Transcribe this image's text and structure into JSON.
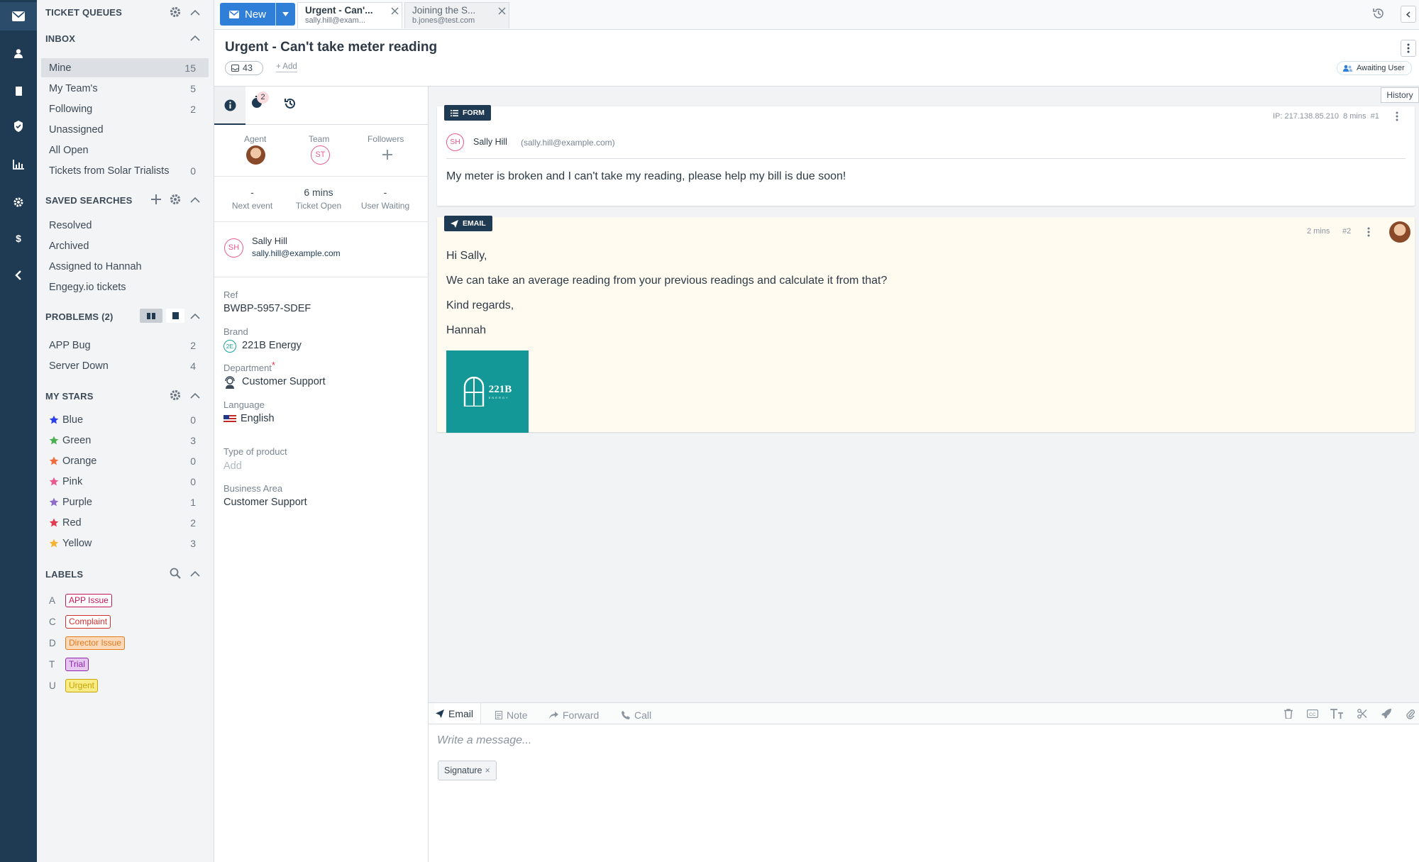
{
  "rail": {
    "icons": [
      "mail-icon",
      "user-icon",
      "book-icon",
      "check-shield-icon",
      "bar-chart-icon",
      "cog-icon",
      "dollar-icon",
      "chevron-left-icon"
    ]
  },
  "sidebar": {
    "queues_title": "TICKET QUEUES",
    "inbox_title": "INBOX",
    "inbox": [
      {
        "label": "Mine",
        "count": "15"
      },
      {
        "label": "My Team's",
        "count": "5"
      },
      {
        "label": "Following",
        "count": "2"
      },
      {
        "label": "Unassigned",
        "count": ""
      },
      {
        "label": "All Open",
        "count": ""
      },
      {
        "label": "Tickets from Solar Trialists",
        "count": "0"
      }
    ],
    "saved_title": "SAVED SEARCHES",
    "saved": [
      {
        "label": "Resolved"
      },
      {
        "label": "Archived"
      },
      {
        "label": "Assigned to Hannah"
      },
      {
        "label": "Engegy.io tickets"
      }
    ],
    "problems_title": "PROBLEMS (2)",
    "problems": [
      {
        "label": "APP Bug",
        "count": "2"
      },
      {
        "label": "Server Down",
        "count": "4"
      }
    ],
    "stars_title": "MY STARS",
    "stars": [
      {
        "label": "Blue",
        "count": "0",
        "color": "#2b3ff0"
      },
      {
        "label": "Green",
        "count": "3",
        "color": "#4caf50"
      },
      {
        "label": "Orange",
        "count": "0",
        "color": "#f26b3a"
      },
      {
        "label": "Pink",
        "count": "0",
        "color": "#e8598f"
      },
      {
        "label": "Purple",
        "count": "1",
        "color": "#8e6cc9"
      },
      {
        "label": "Red",
        "count": "2",
        "color": "#e53950"
      },
      {
        "label": "Yellow",
        "count": "3",
        "color": "#f5b332"
      }
    ],
    "labels_title": "LABELS",
    "labels": [
      {
        "letter": "A",
        "label": "APP Issue",
        "color": "#c2185b",
        "bg": "#fff"
      },
      {
        "letter": "C",
        "label": "Complaint",
        "color": "#d32f2f",
        "bg": "#fff"
      },
      {
        "letter": "D",
        "label": "Director Issue",
        "color": "#e07a1f",
        "bg": "#fbd9b9"
      },
      {
        "letter": "T",
        "label": "Trial",
        "color": "#8e24aa",
        "bg": "#e5c7f0"
      },
      {
        "letter": "U",
        "label": "Urgent",
        "color": "#c9a400",
        "bg": "#f8ec86"
      }
    ]
  },
  "topbar": {
    "new_label": "New",
    "tabs": [
      {
        "title": "Urgent - Can'...",
        "sub": "sally.hill@exam..."
      },
      {
        "title": "Joining the S...",
        "sub": "b.jones@test.com"
      }
    ]
  },
  "ticket": {
    "title": "Urgent - Can't take meter reading",
    "count": "43",
    "add_label": "+ Add",
    "status": "Awaiting User",
    "history_tooltip": "History"
  },
  "props": {
    "tab_badge": "2",
    "agent_label": "Agent",
    "team_label": "Team",
    "followers_label": "Followers",
    "team_initials": "ST",
    "stats": [
      {
        "value": "-",
        "label": "Next event"
      },
      {
        "value": "6 mins",
        "label": "Ticket Open"
      },
      {
        "value": "-",
        "label": "User Waiting"
      }
    ],
    "user_initials": "SH",
    "user_name": "Sally Hill",
    "user_email": "sally.hill@example.com",
    "ref_label": "Ref",
    "ref_value": "BWBP-5957-SDEF",
    "brand_label": "Brand",
    "brand_initials": "2E",
    "brand_value": "221B Energy",
    "dept_label": "Department",
    "dept_req": "*",
    "dept_value": "Customer Support",
    "lang_label": "Language",
    "lang_value": "English",
    "product_label": "Type of product",
    "product_value": "Add",
    "area_label": "Business Area",
    "area_value": "Customer Support"
  },
  "messages": [
    {
      "badge": "FORM",
      "meta": "IP: 217.138.85.210  8 mins  #1",
      "initials": "SH",
      "name": "Sally Hill",
      "email": "(sally.hill@example.com)",
      "body": "My meter is broken and I can't take my reading, please help my bill is due soon!"
    },
    {
      "badge": "EMAIL",
      "time": "2 mins",
      "num": "#2",
      "lines": [
        "Hi Sally,",
        "We can take an average reading from your previous readings and calculate it from that?",
        "Kind regards,",
        "Hannah"
      ],
      "logo_text": "221B",
      "logo_sub": "ENERGY"
    }
  ],
  "composer": {
    "tabs": [
      "Email",
      "Note",
      "Forward",
      "Call"
    ],
    "placeholder": "Write a message...",
    "signature": "Signature",
    "signature_x": "×"
  },
  "colors": {
    "rail": "#1f3a53",
    "accent": "#2f7ed8",
    "email_bg": "#fffbf0"
  }
}
